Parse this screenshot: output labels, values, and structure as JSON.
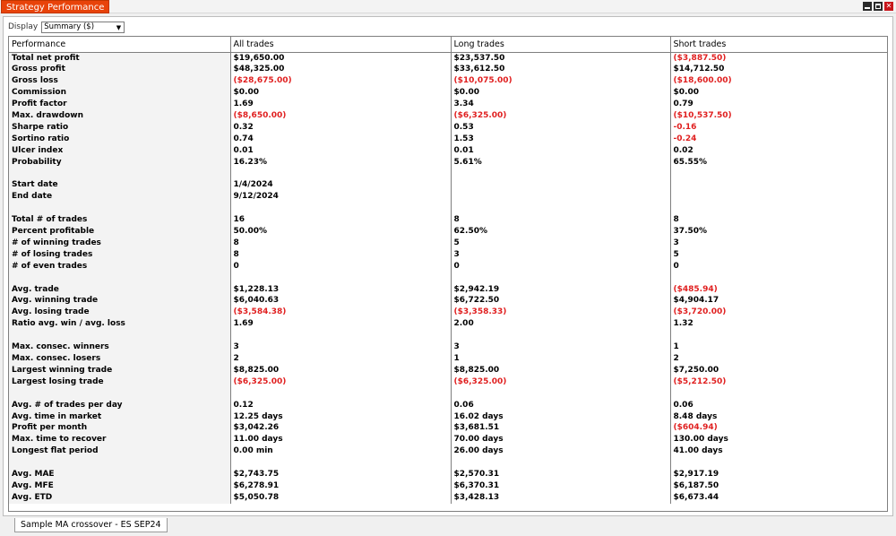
{
  "window": {
    "title": "Strategy Performance",
    "minimize_icon": "minimize-icon",
    "maximize_icon": "maximize-icon",
    "close_icon": "close-icon",
    "close_glyph": "✕"
  },
  "display": {
    "label": "Display",
    "selected": "Summary ($)"
  },
  "columns": [
    "Performance",
    "All trades",
    "Long trades",
    "Short trades"
  ],
  "rows": [
    {
      "label": "Total net profit",
      "values": [
        "$19,650.00",
        "$23,537.50",
        "($3,887.50)"
      ],
      "neg": [
        false,
        false,
        true
      ]
    },
    {
      "label": "Gross profit",
      "values": [
        "$48,325.00",
        "$33,612.50",
        "$14,712.50"
      ],
      "neg": [
        false,
        false,
        false
      ]
    },
    {
      "label": "Gross loss",
      "values": [
        "($28,675.00)",
        "($10,075.00)",
        "($18,600.00)"
      ],
      "neg": [
        true,
        true,
        true
      ]
    },
    {
      "label": "Commission",
      "values": [
        "$0.00",
        "$0.00",
        "$0.00"
      ],
      "neg": [
        false,
        false,
        false
      ]
    },
    {
      "label": "Profit factor",
      "values": [
        "1.69",
        "3.34",
        "0.79"
      ],
      "neg": [
        false,
        false,
        false
      ]
    },
    {
      "label": "Max. drawdown",
      "values": [
        "($8,650.00)",
        "($6,325.00)",
        "($10,537.50)"
      ],
      "neg": [
        true,
        true,
        true
      ]
    },
    {
      "label": "Sharpe ratio",
      "values": [
        "0.32",
        "0.53",
        "-0.16"
      ],
      "neg": [
        false,
        false,
        true
      ]
    },
    {
      "label": "Sortino ratio",
      "values": [
        "0.74",
        "1.53",
        "-0.24"
      ],
      "neg": [
        false,
        false,
        true
      ]
    },
    {
      "label": "Ulcer index",
      "values": [
        "0.01",
        "0.01",
        "0.02"
      ],
      "neg": [
        false,
        false,
        false
      ]
    },
    {
      "label": "Probability",
      "values": [
        "16.23%",
        "5.61%",
        "65.55%"
      ],
      "neg": [
        false,
        false,
        false
      ]
    },
    {
      "label": "",
      "values": [
        "",
        "",
        ""
      ],
      "neg": [
        false,
        false,
        false
      ]
    },
    {
      "label": "Start date",
      "values": [
        "1/4/2024",
        "",
        ""
      ],
      "neg": [
        false,
        false,
        false
      ]
    },
    {
      "label": "End date",
      "values": [
        "9/12/2024",
        "",
        ""
      ],
      "neg": [
        false,
        false,
        false
      ]
    },
    {
      "label": "",
      "values": [
        "",
        "",
        ""
      ],
      "neg": [
        false,
        false,
        false
      ]
    },
    {
      "label": "Total # of trades",
      "values": [
        "16",
        "8",
        "8"
      ],
      "neg": [
        false,
        false,
        false
      ]
    },
    {
      "label": "Percent profitable",
      "values": [
        "50.00%",
        "62.50%",
        "37.50%"
      ],
      "neg": [
        false,
        false,
        false
      ]
    },
    {
      "label": "# of winning trades",
      "values": [
        "8",
        "5",
        "3"
      ],
      "neg": [
        false,
        false,
        false
      ]
    },
    {
      "label": "# of losing trades",
      "values": [
        "8",
        "3",
        "5"
      ],
      "neg": [
        false,
        false,
        false
      ]
    },
    {
      "label": "# of even trades",
      "values": [
        "0",
        "0",
        "0"
      ],
      "neg": [
        false,
        false,
        false
      ]
    },
    {
      "label": "",
      "values": [
        "",
        "",
        ""
      ],
      "neg": [
        false,
        false,
        false
      ]
    },
    {
      "label": "Avg. trade",
      "values": [
        "$1,228.13",
        "$2,942.19",
        "($485.94)"
      ],
      "neg": [
        false,
        false,
        true
      ]
    },
    {
      "label": "Avg. winning trade",
      "values": [
        "$6,040.63",
        "$6,722.50",
        "$4,904.17"
      ],
      "neg": [
        false,
        false,
        false
      ]
    },
    {
      "label": "Avg. losing trade",
      "values": [
        "($3,584.38)",
        "($3,358.33)",
        "($3,720.00)"
      ],
      "neg": [
        true,
        true,
        true
      ]
    },
    {
      "label": "Ratio avg. win / avg. loss",
      "values": [
        "1.69",
        "2.00",
        "1.32"
      ],
      "neg": [
        false,
        false,
        false
      ]
    },
    {
      "label": "",
      "values": [
        "",
        "",
        ""
      ],
      "neg": [
        false,
        false,
        false
      ]
    },
    {
      "label": "Max. consec. winners",
      "values": [
        "3",
        "3",
        "1"
      ],
      "neg": [
        false,
        false,
        false
      ]
    },
    {
      "label": "Max. consec. losers",
      "values": [
        "2",
        "1",
        "2"
      ],
      "neg": [
        false,
        false,
        false
      ]
    },
    {
      "label": "Largest winning trade",
      "values": [
        "$8,825.00",
        "$8,825.00",
        "$7,250.00"
      ],
      "neg": [
        false,
        false,
        false
      ]
    },
    {
      "label": "Largest losing trade",
      "values": [
        "($6,325.00)",
        "($6,325.00)",
        "($5,212.50)"
      ],
      "neg": [
        true,
        true,
        true
      ]
    },
    {
      "label": "",
      "values": [
        "",
        "",
        ""
      ],
      "neg": [
        false,
        false,
        false
      ]
    },
    {
      "label": "Avg. # of trades per day",
      "values": [
        "0.12",
        "0.06",
        "0.06"
      ],
      "neg": [
        false,
        false,
        false
      ]
    },
    {
      "label": "Avg. time in market",
      "values": [
        "12.25 days",
        "16.02 days",
        "8.48 days"
      ],
      "neg": [
        false,
        false,
        false
      ]
    },
    {
      "label": "Profit per month",
      "values": [
        "$3,042.26",
        "$3,681.51",
        "($604.94)"
      ],
      "neg": [
        false,
        false,
        true
      ]
    },
    {
      "label": "Max. time to recover",
      "values": [
        "11.00 days",
        "70.00 days",
        "130.00 days"
      ],
      "neg": [
        false,
        false,
        false
      ]
    },
    {
      "label": "Longest flat period",
      "values": [
        "0.00 min",
        "26.00 days",
        "41.00 days"
      ],
      "neg": [
        false,
        false,
        false
      ]
    },
    {
      "label": "",
      "values": [
        "",
        "",
        ""
      ],
      "neg": [
        false,
        false,
        false
      ]
    },
    {
      "label": "Avg. MAE",
      "values": [
        "$2,743.75",
        "$2,570.31",
        "$2,917.19"
      ],
      "neg": [
        false,
        false,
        false
      ]
    },
    {
      "label": "Avg. MFE",
      "values": [
        "$6,278.91",
        "$6,370.31",
        "$6,187.50"
      ],
      "neg": [
        false,
        false,
        false
      ]
    },
    {
      "label": "Avg. ETD",
      "values": [
        "$5,050.78",
        "$3,428.13",
        "$6,673.44"
      ],
      "neg": [
        false,
        false,
        false
      ]
    }
  ],
  "bottom_tab": "Sample MA crossover - ES SEP24",
  "colors": {
    "accent": "#e8430a",
    "negative": "#e01f1f",
    "label_bg": "#f3f3f3"
  }
}
